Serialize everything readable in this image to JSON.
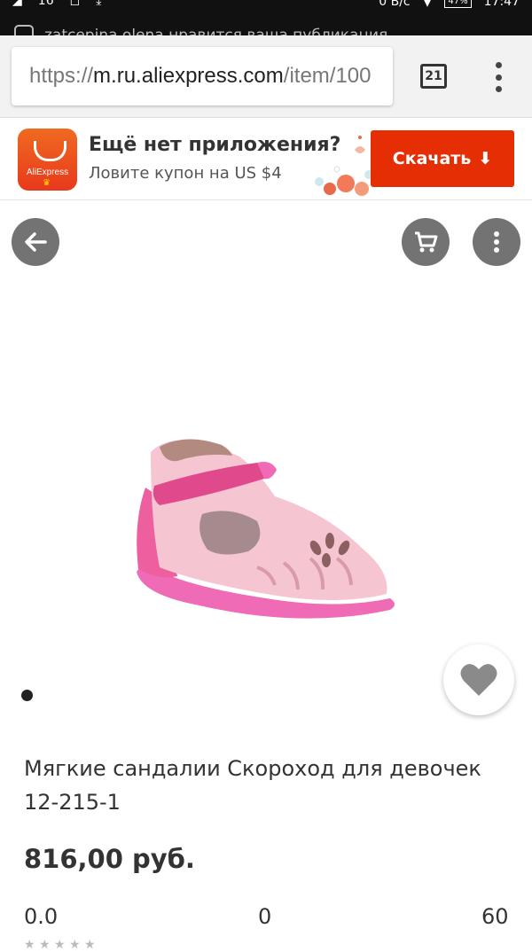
{
  "status_bar": {
    "left_text": "16",
    "speed": "0 B/c",
    "battery": "47%",
    "time": "17:47"
  },
  "notification": {
    "text": "zatcepina.olena нравится ваша публикация"
  },
  "browser": {
    "url_scheme": "https://",
    "url_host": "m.ru.aliexpress.com",
    "url_path": "/item/100",
    "tab_count": "21"
  },
  "app_banner": {
    "logo_text": "AliExpress",
    "title": "Ещё нет приложения?",
    "subtitle": "Ловите купон на US $4",
    "download_label": "Скачать"
  },
  "product": {
    "title": "Мягкие сандалии Скороход для девочек 12-215-1",
    "price": "816,00 руб.",
    "rating": "0.0",
    "reviews": "0",
    "orders": "60"
  },
  "colors": {
    "accent": "#e62e04",
    "logo": "#f06a20"
  }
}
